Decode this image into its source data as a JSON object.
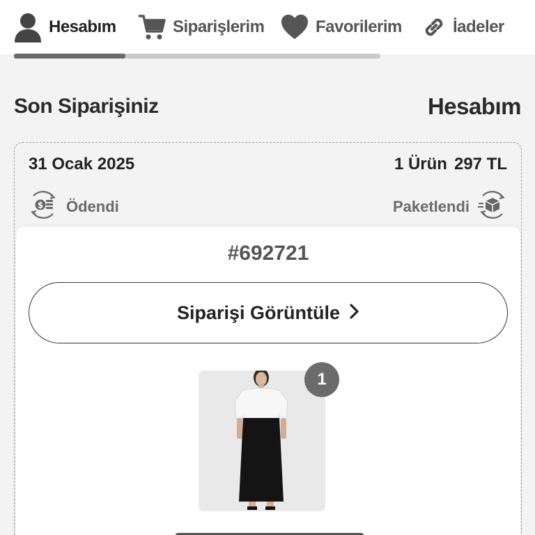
{
  "nav": {
    "items": [
      {
        "label": "Hesabım",
        "icon": "user-icon"
      },
      {
        "label": "Siparişlerim",
        "icon": "cart-icon"
      },
      {
        "label": "Favorilerim",
        "icon": "heart-icon"
      },
      {
        "label": "İadeler",
        "icon": "link-icon"
      }
    ]
  },
  "section": {
    "title": "Son Siparişiniz",
    "link": "Hesabım"
  },
  "order": {
    "date": "31 Ocak 2025",
    "item_count": "1 Ürün",
    "total": "297 TL",
    "payment_status": "Ödendi",
    "shipping_status": "Paketlendi",
    "number": "#692721",
    "view_button": "Siparişi Görüntüle",
    "product_quantity": "1"
  },
  "colors": {
    "background": "#f3f3f3",
    "card": "#ffffff",
    "text": "#2a2a2a",
    "muted": "#6a6a6a",
    "badge": "#6b6b6b"
  }
}
